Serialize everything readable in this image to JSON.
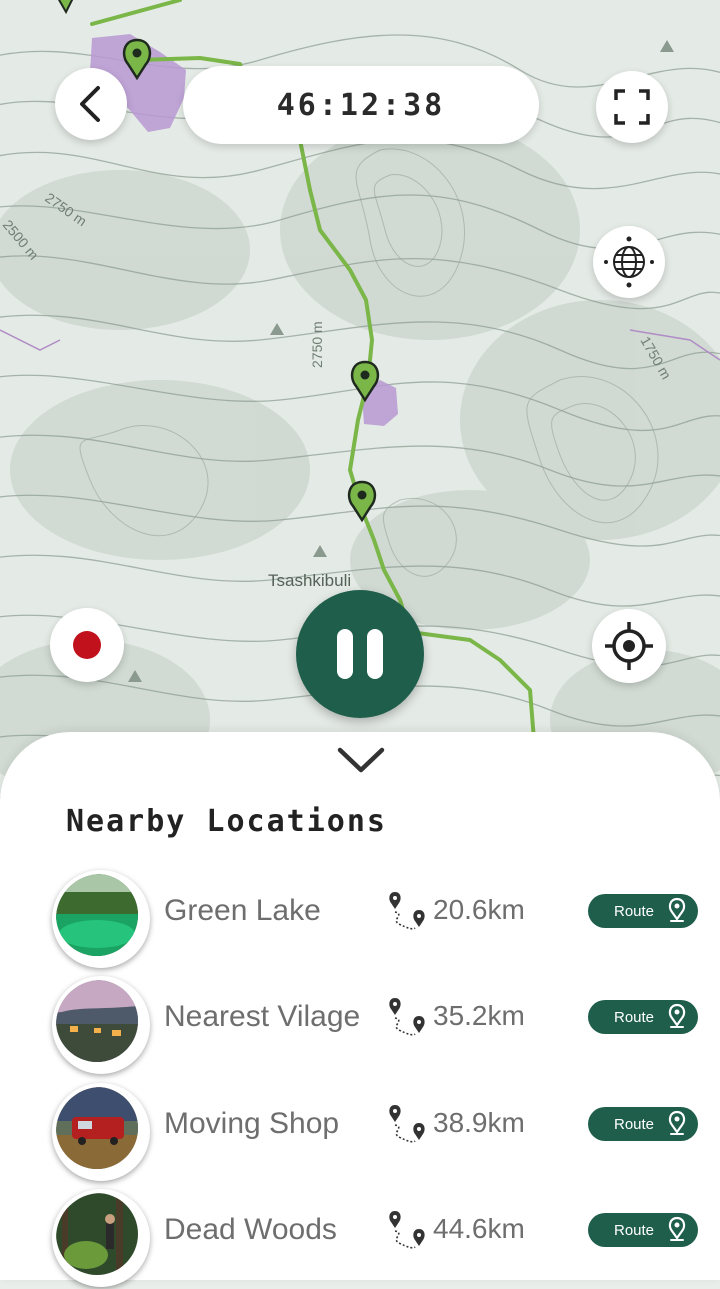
{
  "timer": {
    "value": "46:12:38"
  },
  "map": {
    "labels": {
      "elev_1": "2750 m",
      "elev_2": "2500 m",
      "elev_3": "2750 m",
      "elev_4": "1750 m",
      "place": "Tsashkibuli"
    },
    "colors": {
      "trail": "#7ab648",
      "area": "#b898d4",
      "marker": "#7ab648"
    }
  },
  "controls": {
    "back_icon": "chevron-left-icon",
    "fullscreen_icon": "fullscreen-icon",
    "globe_icon": "globe-icon",
    "record_icon": "record-icon",
    "pause_icon": "pause-icon",
    "locate_icon": "crosshair-icon",
    "collapse_icon": "chevron-down-icon",
    "record_color": "#c0111c",
    "accent": "#1e5e4b"
  },
  "sheet": {
    "title": "Nearby Locations",
    "locations": [
      {
        "name": "Green Lake",
        "distance": "20.6km",
        "route_label": "Route"
      },
      {
        "name": "Nearest Vilage",
        "distance": "35.2km",
        "route_label": "Route"
      },
      {
        "name": "Moving Shop",
        "distance": "38.9km",
        "route_label": "Route"
      },
      {
        "name": "Dead Woods",
        "distance": "44.6km",
        "route_label": "Route"
      }
    ]
  }
}
